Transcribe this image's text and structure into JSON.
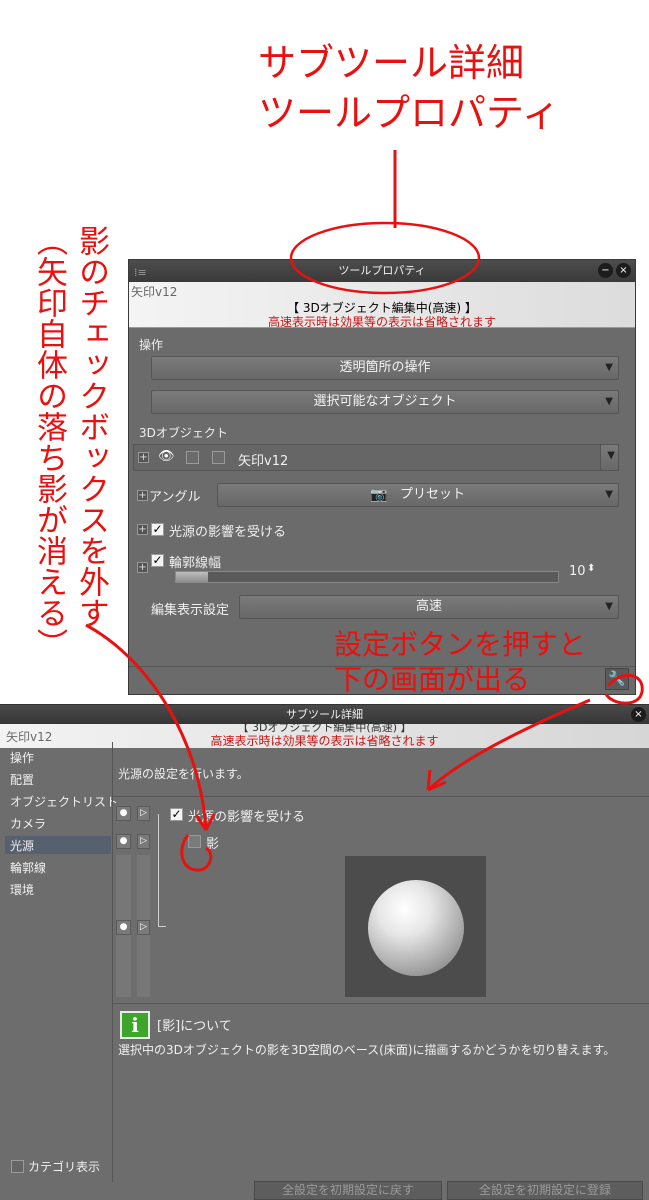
{
  "annotations": {
    "title_line1": "サブツール詳細",
    "title_line2": "ツールプロパティ",
    "shadow_note_col1": "影のチェックボックスを外す",
    "shadow_note_col2": "（矢印自体の落ち影が消える）",
    "settings_note_line1": "設定ボタンを押すと",
    "settings_note_line2": "下の画面が出る",
    "color": "#e8110f"
  },
  "tool_property": {
    "title": "ツールプロパティ",
    "minimize_icon": "−",
    "close_icon": "×",
    "tool_name": "矢印v12",
    "mode": "【 3Dオブジェクト編集中(高速) 】",
    "note": "高速表示時は効果等の表示は省略されます",
    "section_operation": "操作",
    "dropdown_transparent": "透明箇所の操作",
    "dropdown_selectable": "選択可能なオブジェクト",
    "section_3d": "3Dオブジェクト",
    "object_name": "矢印v12",
    "angle_label": "アングル",
    "angle_value": "プリセット",
    "light_label": "光源の影響を受ける",
    "outline_label": "輪郭線幅",
    "outline_value": "10",
    "edit_display_label": "編集表示設定",
    "edit_display_value": "高速"
  },
  "subtool_detail": {
    "title": "サブツール詳細",
    "close_icon": "×",
    "tool_name": "矢印v12",
    "banner_mode_partial": "【 3Dオブジェクト編集中(高速) 】",
    "note": "高速表示時は効果等の表示は省略されます",
    "categories": [
      "操作",
      "配置",
      "オブジェクトリスト",
      "カメラ",
      "光源",
      "輪郭線",
      "環境"
    ],
    "selected_category": "光源",
    "description": "光源の設定を行います。",
    "light_label": "光源の影響を受ける",
    "shadow_label": "影",
    "info_title": "[影]について",
    "info_text": "選択中の3Dオブジェクトの影を3D空間のベース(床面)に描画するかどうかを切り替えます。",
    "show_category_label": "カテゴリ表示",
    "reset_button": "全設定を初期設定に戻す",
    "register_button": "全設定を初期設定に登録"
  }
}
